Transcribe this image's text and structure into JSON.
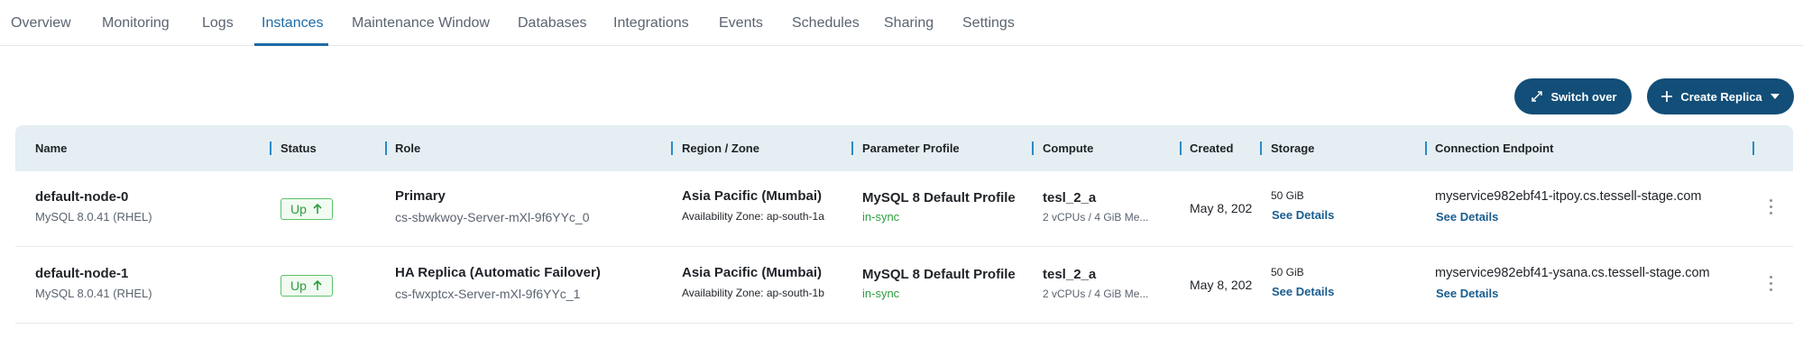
{
  "tabs": [
    {
      "label": "Overview"
    },
    {
      "label": "Monitoring"
    },
    {
      "label": "Logs"
    },
    {
      "label": "Instances"
    },
    {
      "label": "Maintenance Window"
    },
    {
      "label": "Databases"
    },
    {
      "label": "Integrations"
    },
    {
      "label": "Events"
    },
    {
      "label": "Schedules"
    },
    {
      "label": "Sharing"
    },
    {
      "label": "Settings"
    }
  ],
  "active_tab": "Instances",
  "actions": {
    "switch_over_label": "Switch over",
    "create_replica_label": "Create Replica"
  },
  "table": {
    "headers": {
      "name": "Name",
      "status": "Status",
      "role": "Role",
      "region": "Region / Zone",
      "parameter_profile": "Parameter Profile",
      "compute": "Compute",
      "created": "Created",
      "storage": "Storage",
      "endpoint": "Connection Endpoint"
    },
    "rows": [
      {
        "name": "default-node-0",
        "engine": "MySQL 8.0.41 (RHEL)",
        "status": "Up",
        "role": "Primary",
        "role_sub": "cs-sbwkwoy-Server-mXl-9f6YYc_0",
        "region": "Asia Pacific (Mumbai)",
        "zone": "Availability Zone: ap-south-1a",
        "profile": "MySQL 8 Default Profile",
        "profile_status": "in-sync",
        "compute": "tesl_2_a",
        "compute_sub": "2 vCPUs / 4 GiB Me...",
        "created": "May 8, 202",
        "storage": "50 GiB",
        "storage_link": "See Details",
        "endpoint": "myservice982ebf41-itpoy.cs.tessell-stage.com",
        "endpoint_link": "See Details"
      },
      {
        "name": "default-node-1",
        "engine": "MySQL 8.0.41 (RHEL)",
        "status": "Up",
        "role": "HA Replica (Automatic Failover)",
        "role_sub": "cs-fwxptcx-Server-mXl-9f6YYc_1",
        "region": "Asia Pacific (Mumbai)",
        "zone": "Availability Zone: ap-south-1b",
        "profile": "MySQL 8 Default Profile",
        "profile_status": "in-sync",
        "compute": "tesl_2_a",
        "compute_sub": "2 vCPUs / 4 GiB Me...",
        "created": "May 8, 202",
        "storage": "50 GiB",
        "storage_link": "See Details",
        "endpoint": "myservice982ebf41-ysana.cs.tessell-stage.com",
        "endpoint_link": "See Details"
      }
    ]
  },
  "colors": {
    "accent": "#1e6aa6",
    "button_bg": "#124e78",
    "header_bg": "#e4eef3",
    "status_green": "#2e9d3f",
    "link": "#1a5d8f"
  },
  "icons": {
    "switch_over": "diagonal-arrows-icon",
    "create_replica": "plus-icon",
    "create_replica_menu": "caret-down-icon",
    "status_up": "arrow-up-icon",
    "row_menu": "kebab-icon"
  }
}
